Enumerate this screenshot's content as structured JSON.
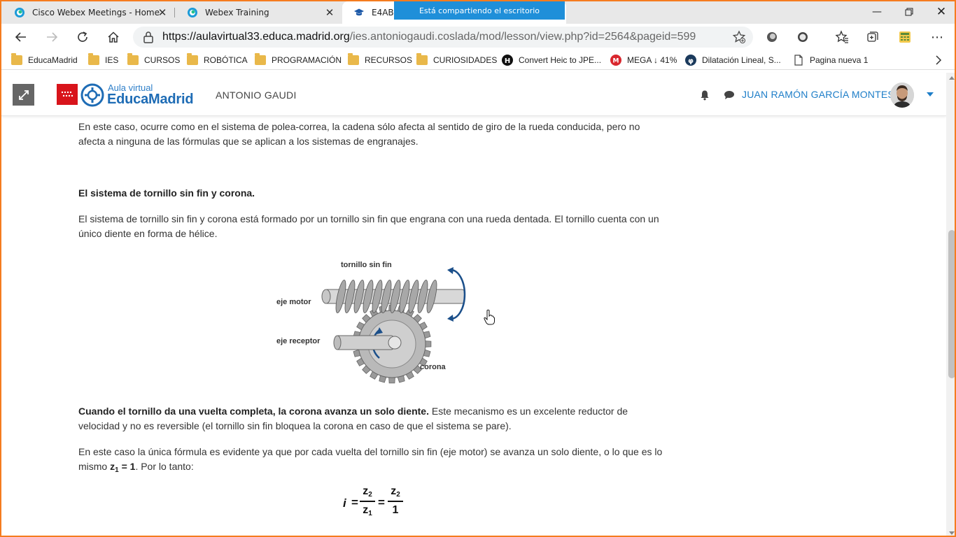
{
  "browser": {
    "tabs": [
      {
        "title": "Cisco Webex Meetings - Home"
      },
      {
        "title": "Webex Training"
      },
      {
        "title": "E4ABC:"
      }
    ],
    "share_banner": "Está compartiendo el escritorio",
    "url_host": "https://aulavirtual33.educa.madrid.org",
    "url_path": "/ies.antoniogaudi.coslada/mod/lesson/view.php?id=2564&pageid=599"
  },
  "bookmarks": [
    {
      "label": "EducaMadrid",
      "icon": "folder-icon"
    },
    {
      "label": "IES",
      "icon": "folder-icon"
    },
    {
      "label": "CURSOS",
      "icon": "folder-icon"
    },
    {
      "label": "ROBÓTICA",
      "icon": "folder-icon"
    },
    {
      "label": "PROGRAMACIÓN",
      "icon": "folder-icon"
    },
    {
      "label": "RECURSOS",
      "icon": "folder-icon"
    },
    {
      "label": "CURIOSIDADES",
      "icon": "folder-icon"
    },
    {
      "label": "Convert Heic to JPE...",
      "icon": "h-icon"
    },
    {
      "label": "MEGA ↓ 41%",
      "icon": "mega-icon"
    },
    {
      "label": "Dilatación Lineal, S...",
      "icon": "phet-icon"
    },
    {
      "label": "Pagina nueva 1",
      "icon": "page-icon"
    }
  ],
  "header": {
    "logo_sub": "Aula virtual",
    "logo_main": "EducaMadrid",
    "site_name": "ANTONIO GAUDI",
    "user_name": "JUAN RAMÓN GARCÍA MONTES"
  },
  "content": {
    "p1": "En este caso, ocurre como en el sistema de polea-correa, la cadena sólo afecta al sentido de giro de la rueda conducida, pero no afecta a ninguna de las fórmulas que se aplican a los sistemas de engranajes.",
    "heading": "El sistema de tornillo sin fin y corona.",
    "p2": "El sistema de tornillo sin fin y corona está formado por un tornillo sin fin que engrana con una rueda dentada. El tornillo cuenta con un único diente en forma de hélice.",
    "figure": {
      "label_tornillo": "tornillo sin fin",
      "label_eje_motor": "eje motor",
      "label_eje_receptor": "eje receptor",
      "label_corona": "corona"
    },
    "p3_bold": "Cuando el tornillo da una vuelta completa, la corona avanza un solo diente.",
    "p3_rest": " Este mecanismo es un excelente reductor de velocidad y no es reversible (el tornillo sin fin bloquea la corona en caso de que el sistema se pare).",
    "p4_start": "En este caso la única fórmula es evidente ya que por cada vuelta del tornillo sin fin (eje motor) se avanza un solo diente, o lo que es lo mismo ",
    "p4_z": "z",
    "p4_sub": "1",
    "p4_eq": " = 1",
    "p4_end": ". Por lo tanto:",
    "formula": {
      "i": "i",
      "eq": "=",
      "z": "z",
      "sub2": "2",
      "sub1": "1",
      "one": "1"
    }
  }
}
